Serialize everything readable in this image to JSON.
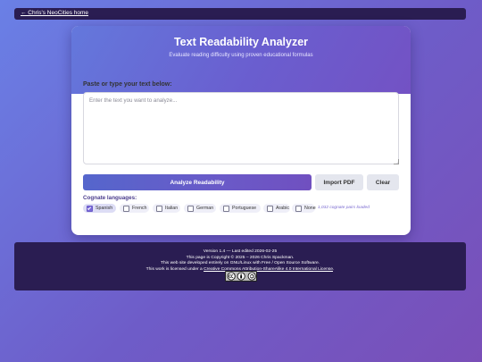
{
  "nav": {
    "home_link": "← Chris's NeoCities home"
  },
  "header": {
    "title": "Text Readability Analyzer",
    "subtitle": "Evaluate reading difficulty using proven educational formulas"
  },
  "input": {
    "label": "Paste or type your text below:",
    "placeholder": "Enter the text you want to analyze...",
    "value": ""
  },
  "buttons": {
    "analyze": "Analyze Readability",
    "import_pdf": "Import PDF",
    "clear": "Clear"
  },
  "cognates": {
    "label": "Cognate languages:",
    "languages": [
      {
        "label": "Spanish",
        "checked": true
      },
      {
        "label": "French",
        "checked": false
      },
      {
        "label": "Italian",
        "checked": false
      },
      {
        "label": "German",
        "checked": false
      },
      {
        "label": "Portuguese",
        "checked": false
      },
      {
        "label": "Arabic",
        "checked": false
      },
      {
        "label": "None",
        "checked": false
      }
    ],
    "pairs_loaded": "1,032 cognate pairs loaded"
  },
  "footer": {
    "version": "Version 1.4 — Last edited 2026-02-25",
    "copyright": "This page is Copyright © 2025 – 2026 Chris Spackman.",
    "developed": "This web site developed entirely on GNU/Linux with Free / Open Source Software.",
    "license_prefix": "This work is licensed under a",
    "license_link": "Creative Commons Attribution-ShareAlike 4.0 International License",
    "license_suffix": "."
  },
  "colors": {
    "accent": "#6a5ac8",
    "panel_dark": "#2a1d52",
    "header_start": "#6478dc",
    "header_end": "#7352c4"
  }
}
